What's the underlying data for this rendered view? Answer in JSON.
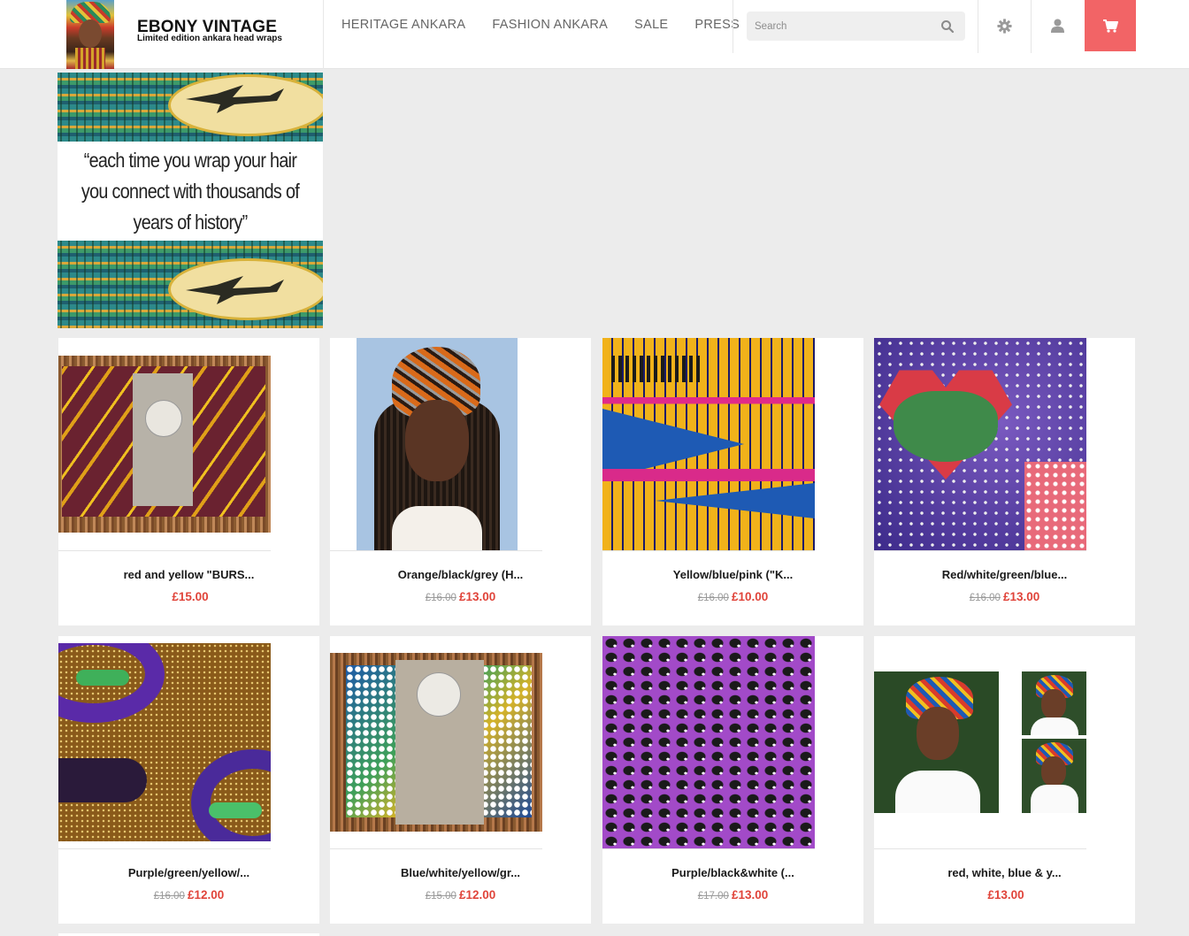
{
  "brand": {
    "title": "EBONY VINTAGE",
    "subtitle": "Limited edition ankara head wraps"
  },
  "nav": {
    "items": [
      {
        "label": "HERITAGE ANKARA"
      },
      {
        "label": "FASHION ANKARA"
      },
      {
        "label": "SALE"
      },
      {
        "label": "PRESS"
      }
    ]
  },
  "search": {
    "placeholder": "Search",
    "value": ""
  },
  "icons": {
    "search": "search-icon",
    "settings": "gear-icon",
    "account": "user-icon",
    "cart": "cart-icon"
  },
  "colors": {
    "accent": "#f26466",
    "price": "#e0443a",
    "background": "#ececec"
  },
  "banner": {
    "quote": "“each time you wrap your hair you connect with thousands of years of history”"
  },
  "products": [
    {
      "name": "red and yellow \"BURS...",
      "old_price": "",
      "price": "£15.00"
    },
    {
      "name": "Orange/black/grey (H...",
      "old_price": "£16.00",
      "price": "£13.00"
    },
    {
      "name": "Yellow/blue/pink (\"K...",
      "old_price": "£16.00",
      "price": "£10.00"
    },
    {
      "name": "Red/white/green/blue...",
      "old_price": "£16.00",
      "price": "£13.00"
    },
    {
      "name": "Purple/green/yellow/...",
      "old_price": "£16.00",
      "price": "£12.00"
    },
    {
      "name": "Blue/white/yellow/gr...",
      "old_price": "£15.00",
      "price": "£12.00"
    },
    {
      "name": "Purple/black&white (...",
      "old_price": "£17.00",
      "price": "£13.00"
    },
    {
      "name": "red, white, blue & y...",
      "old_price": "",
      "price": "£13.00"
    }
  ]
}
